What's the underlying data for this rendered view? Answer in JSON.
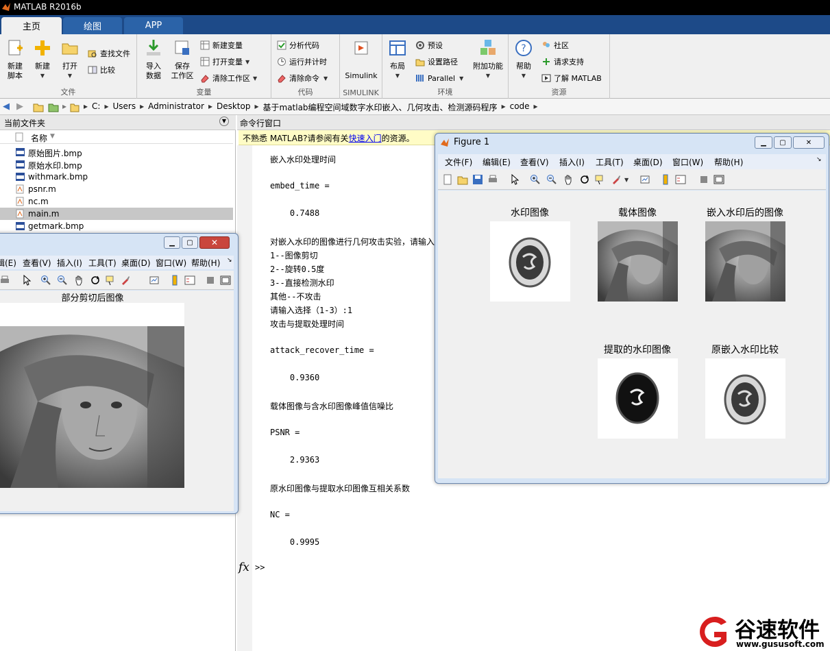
{
  "app": {
    "title": "MATLAB R2016b"
  },
  "tabs": [
    {
      "label": "主页"
    },
    {
      "label": "绘图"
    },
    {
      "label": "APP"
    }
  ],
  "ribbon": {
    "file": {
      "label": "文件",
      "new_script": "新建\n脚本",
      "new": "新建",
      "open": "打开",
      "find_files": "查找文件",
      "compare": "比较"
    },
    "variable": {
      "label": "变量",
      "import": "导入\n数据",
      "save_ws": "保存\n工作区",
      "new_var": "新建变量",
      "open_var": "打开变量",
      "clear_ws": "清除工作区"
    },
    "code": {
      "label": "代码",
      "analyze": "分析代码",
      "run_time": "运行并计时",
      "clear_cmd": "清除命令"
    },
    "simulink": {
      "label": "SIMULINK",
      "btn": "Simulink"
    },
    "env": {
      "label": "环境",
      "layout": "布局",
      "prefs": "预设",
      "set_path": "设置路径",
      "parallel": "Parallel",
      "addons": "附加功能"
    },
    "resources": {
      "label": "资源",
      "help": "帮助",
      "community": "社区",
      "support": "请求支持",
      "learn": "了解 MATLAB"
    }
  },
  "address": {
    "crumbs": [
      "C:",
      "Users",
      "Administrator",
      "Desktop",
      "基于matlab编程空间域数字水印嵌入、几何攻击、检测源码程序",
      "code"
    ]
  },
  "files": {
    "header": "当前文件夹",
    "col_name": "名称",
    "items": [
      {
        "name": "原始图片.bmp",
        "type": "bmp"
      },
      {
        "name": "原始水印.bmp",
        "type": "bmp"
      },
      {
        "name": "withmark.bmp",
        "type": "bmp"
      },
      {
        "name": "psnr.m",
        "type": "m"
      },
      {
        "name": "nc.m",
        "type": "m"
      },
      {
        "name": "main.m",
        "type": "m"
      },
      {
        "name": "getmark.bmp",
        "type": "bmp"
      }
    ]
  },
  "command": {
    "header": "命令行窗口",
    "notice_pre": "不熟悉 MATLAB?请参阅有关",
    "notice_link": "快速入门",
    "notice_post": "的资源。",
    "lines": [
      "嵌入水印处理时间",
      "",
      "embed_time =",
      "",
      "    0.7488",
      "",
      "对嵌入水印的图像进行几何攻击实验，请输入",
      "1--图像剪切",
      "2--旋转0.5度",
      "3--直接检测水印",
      "其他--不攻击",
      "请输入选择（1-3）:1",
      "攻击与提取处理时间",
      "",
      "attack_recover_time =",
      "",
      "    0.9360",
      "",
      "载体图像与含水印图像峰值信噪比",
      "",
      "PSNR =",
      "",
      "    2.9363",
      "",
      "原水印图像与提取水印图像互相关系数",
      "",
      "NC =",
      "",
      "    0.9995"
    ],
    "prompt": ">>",
    "fx": "fx"
  },
  "figure1": {
    "title": "Figure 1",
    "menus": [
      "文件(F)",
      "编辑(E)",
      "查看(V)",
      "插入(I)",
      "工具(T)",
      "桌面(D)",
      "窗口(W)",
      "帮助(H)"
    ],
    "captions": [
      "水印图像",
      "载体图像",
      "嵌入水印后的图像",
      "提取的水印图像",
      "原嵌入水印比较"
    ]
  },
  "figure2": {
    "menus": [
      "辑(E)",
      "查看(V)",
      "插入(I)",
      "工具(T)",
      "桌面(D)",
      "窗口(W)",
      "帮助(H)"
    ],
    "caption": "部分剪切后图像"
  },
  "watermark": {
    "brand": "谷速软件",
    "url": "www.gususoft.com"
  },
  "colors": {
    "tabbar": "#1d4a88",
    "link": "#0000ee",
    "notice": "#fffcc6"
  }
}
